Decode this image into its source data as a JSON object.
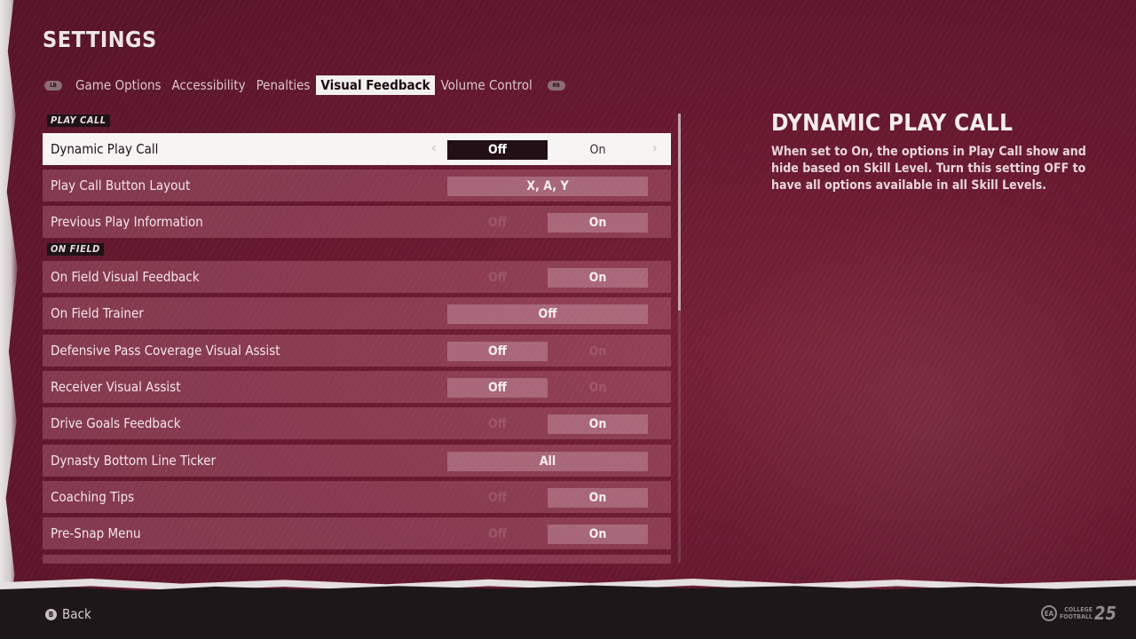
{
  "header": {
    "title": "SETTINGS"
  },
  "tabs": {
    "lb": "LB",
    "rb": "RB",
    "items": [
      "Game Options",
      "Accessibility",
      "Penalties",
      "Visual Feedback",
      "Volume Control"
    ],
    "active_index": 3
  },
  "sections": [
    {
      "label": "PLAY CALL",
      "rows": [
        {
          "label": "Dynamic Play Call",
          "options": [
            "Off",
            "On"
          ],
          "selected": "Off",
          "focused": true
        },
        {
          "label": "Play Call Button Layout",
          "options": [
            "X, A, Y"
          ],
          "selected": "X, A, Y"
        },
        {
          "label": "Previous Play Information",
          "options": [
            "Off",
            "On"
          ],
          "selected": "On"
        }
      ]
    },
    {
      "label": "ON FIELD",
      "rows": [
        {
          "label": "On Field Visual Feedback",
          "options": [
            "Off",
            "On"
          ],
          "selected": "On"
        },
        {
          "label": "On Field Trainer",
          "options": [
            "Off"
          ],
          "selected": "Off"
        },
        {
          "label": "Defensive Pass Coverage Visual Assist",
          "options": [
            "Off",
            "On"
          ],
          "selected": "Off"
        },
        {
          "label": "Receiver Visual Assist",
          "options": [
            "Off",
            "On"
          ],
          "selected": "Off"
        },
        {
          "label": "Drive Goals Feedback",
          "options": [
            "Off",
            "On"
          ],
          "selected": "On"
        },
        {
          "label": "Dynasty Bottom Line Ticker",
          "options": [
            "All"
          ],
          "selected": "All"
        },
        {
          "label": "Coaching Tips",
          "options": [
            "Off",
            "On"
          ],
          "selected": "On"
        },
        {
          "label": "Pre-Snap Menu",
          "options": [
            "Off",
            "On"
          ],
          "selected": "On"
        }
      ]
    }
  ],
  "description": {
    "title": "DYNAMIC PLAY CALL",
    "text": "When set to On, the options in Play Call show and hide based on Skill Level. Turn this setting OFF to have all options available in all Skill Levels."
  },
  "footer": {
    "back_button_glyph": "B",
    "back_label": "Back",
    "logo_ea": "EA",
    "logo_line1": "COLLEGE",
    "logo_line2": "FOOTBALL",
    "logo_number": "25"
  },
  "icons": {
    "arrow_left": "chevron-left-icon",
    "arrow_right": "chevron-right-icon"
  },
  "colors": {
    "background": "#6a1a30",
    "row": "#b06478",
    "selected_row": "#f7f4f4",
    "selected_option": "#221016",
    "active_tab": "#f3f0f0",
    "footer": "#1d1719"
  }
}
